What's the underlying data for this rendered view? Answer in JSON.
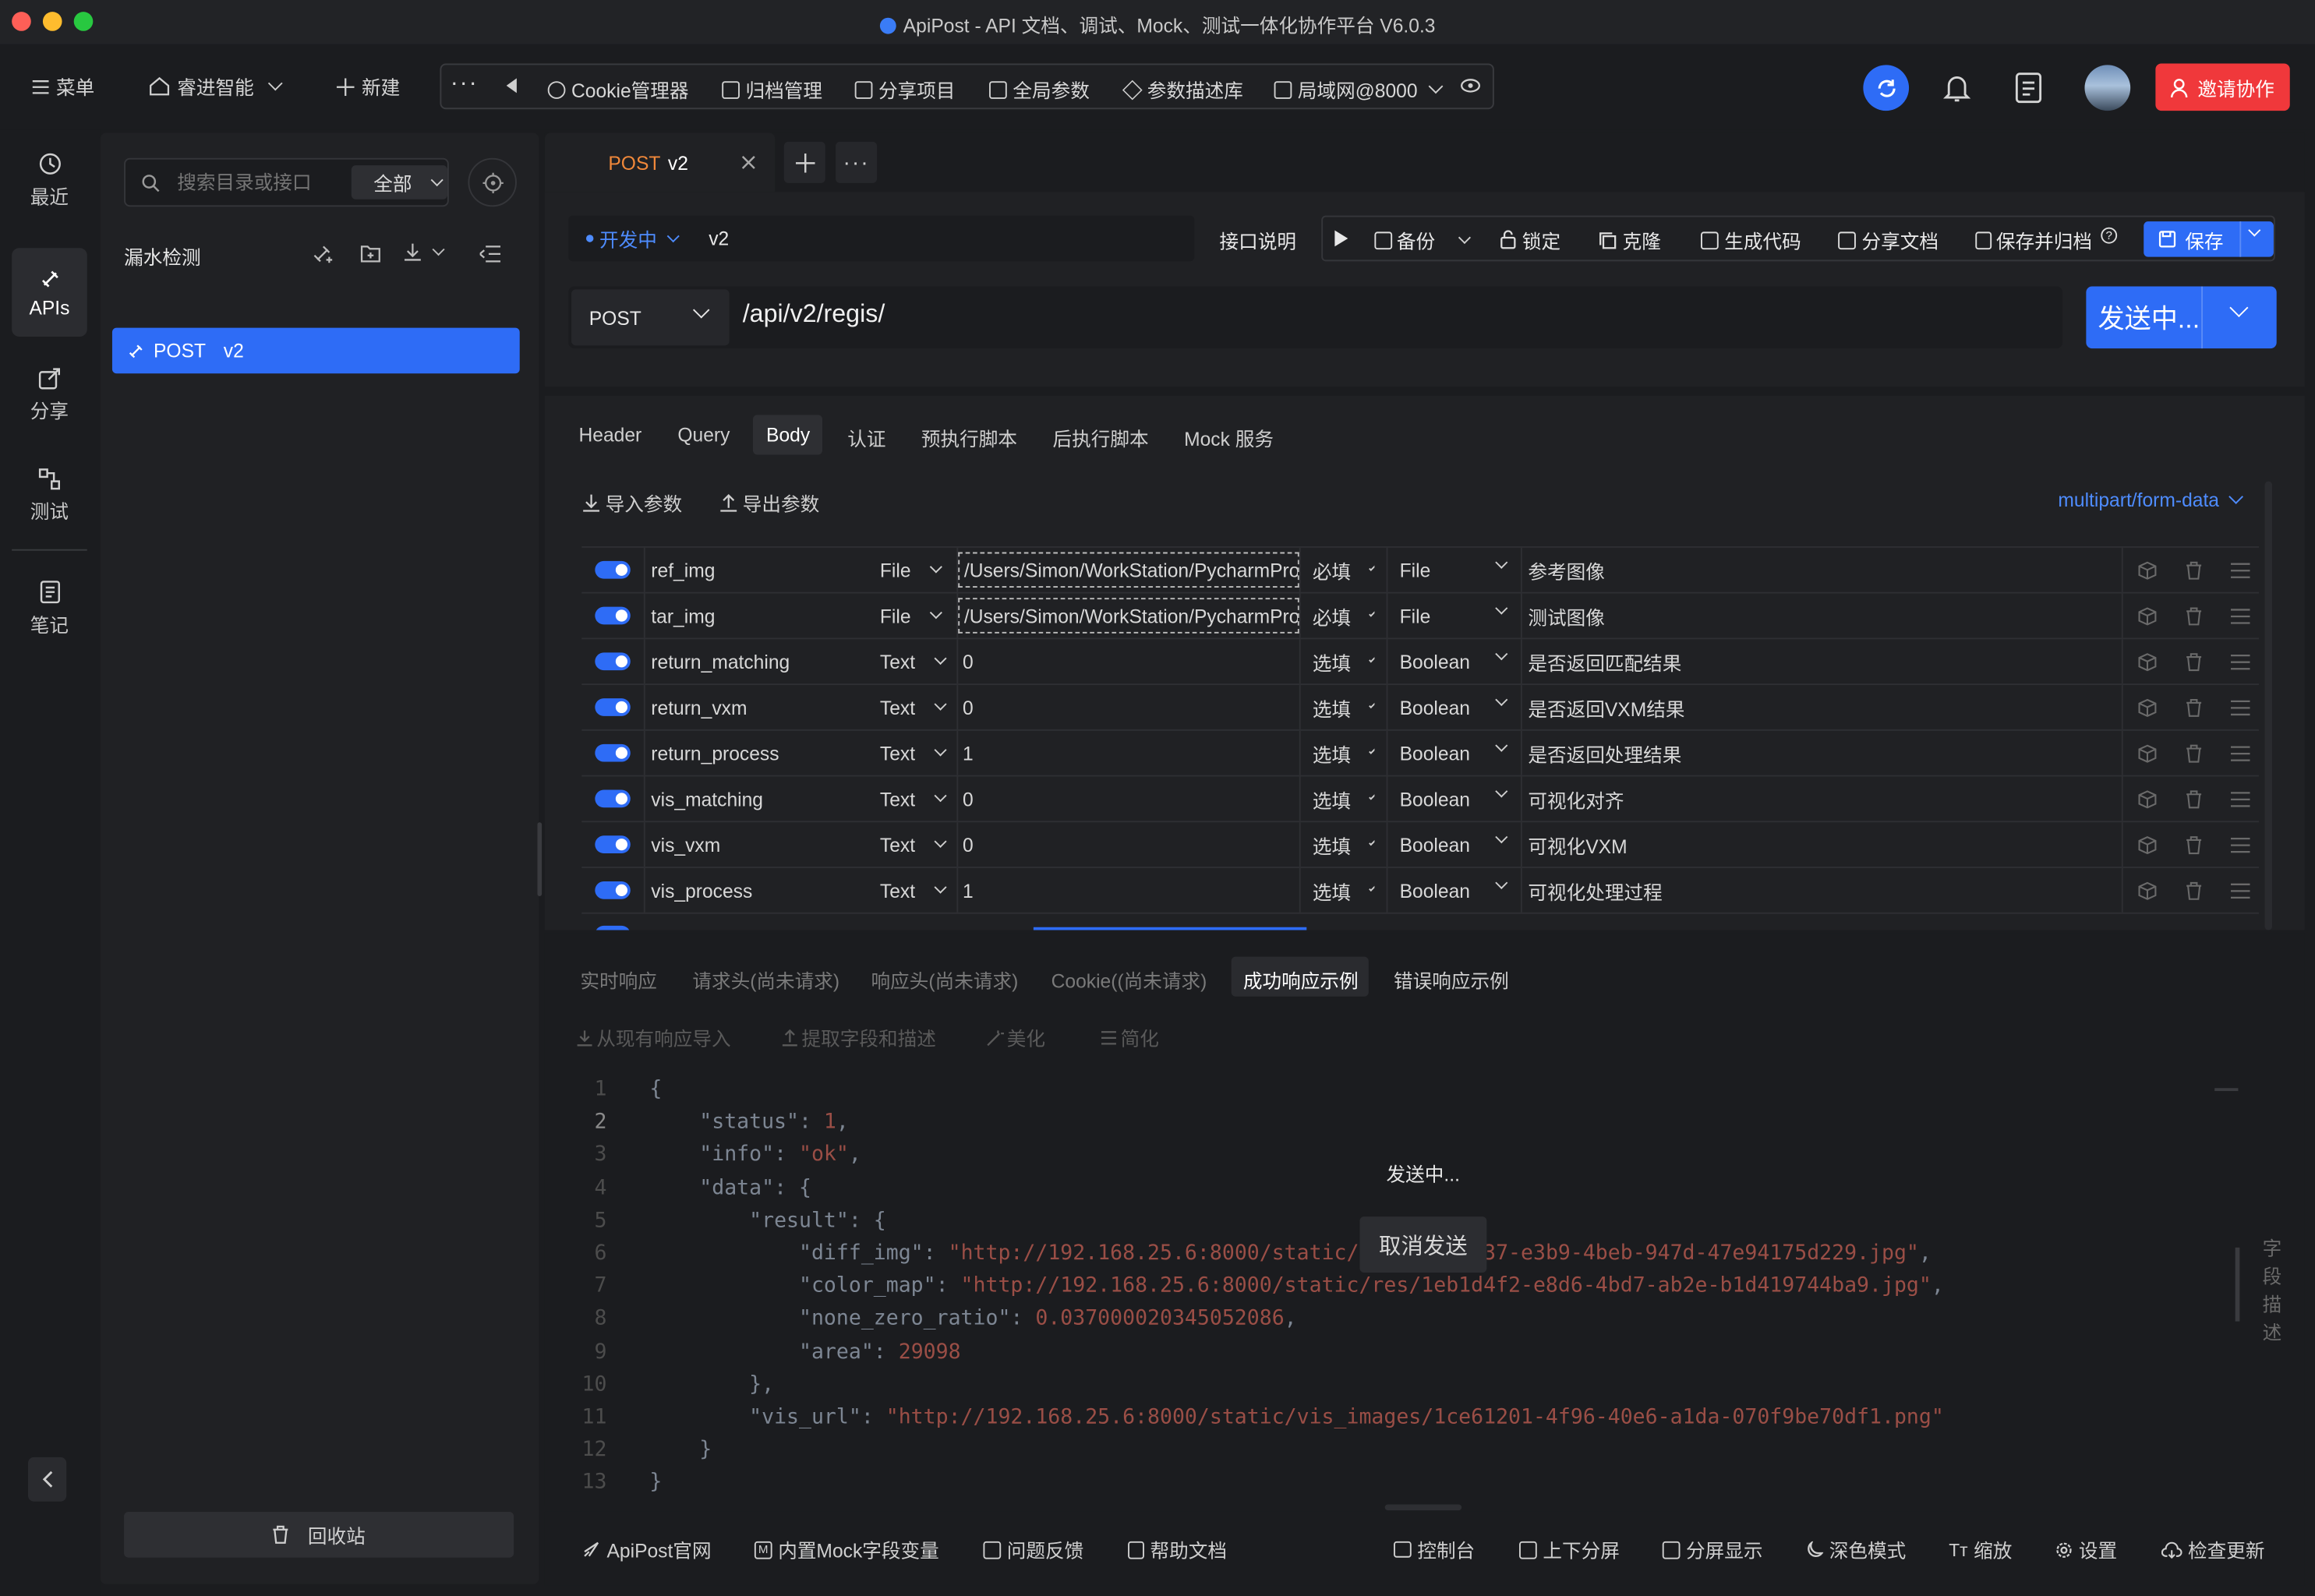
{
  "window": {
    "title": "ApiPost - API 文档、调试、Mock、测试一体化协作平台 V6.0.3"
  },
  "topbar": {
    "menu": "菜单",
    "team": "睿进智能",
    "new": "新建",
    "tools": [
      "Cookie管理器",
      "归档管理",
      "分享项目",
      "全局参数",
      "参数描述库",
      "局域网@8000"
    ],
    "invite": "邀请协作"
  },
  "rail": {
    "items": [
      "最近",
      "APIs",
      "分享",
      "测试",
      "笔记"
    ]
  },
  "sidebar": {
    "search_placeholder": "搜索目录或接口",
    "filter": "全部",
    "project": "漏水检测",
    "tree": [
      {
        "method": "POST",
        "name": "v2"
      }
    ],
    "recycle": "回收站"
  },
  "tab": {
    "method": "POST",
    "name": "v2"
  },
  "request": {
    "env": "开发中",
    "name": "v2",
    "doc": "接口说明",
    "actions": [
      "备份",
      "锁定",
      "克隆",
      "生成代码",
      "分享文档",
      "保存并归档"
    ],
    "save": "保存",
    "method": "POST",
    "url": "/api/v2/regis/",
    "send": "发送中..."
  },
  "body": {
    "tabs": [
      "Header",
      "Query",
      "Body",
      "认证",
      "预执行脚本",
      "后执行脚本",
      "Mock 服务"
    ],
    "import": "导入参数",
    "export": "导出参数",
    "content_type": "multipart/form-data",
    "rows": [
      {
        "key": "ref_img",
        "type": "File",
        "value": "/Users/Simon/WorkStation/PycharmProj",
        "req": "必填",
        "dtype": "File",
        "desc": "参考图像"
      },
      {
        "key": "tar_img",
        "type": "File",
        "value": "/Users/Simon/WorkStation/PycharmProj",
        "req": "必填",
        "dtype": "File",
        "desc": "测试图像"
      },
      {
        "key": "return_matching",
        "type": "Text",
        "value": "0",
        "req": "选填",
        "dtype": "Boolean",
        "desc": "是否返回匹配结果"
      },
      {
        "key": "return_vxm",
        "type": "Text",
        "value": "0",
        "req": "选填",
        "dtype": "Boolean",
        "desc": "是否返回VXM结果"
      },
      {
        "key": "return_process",
        "type": "Text",
        "value": "1",
        "req": "选填",
        "dtype": "Boolean",
        "desc": "是否返回处理结果"
      },
      {
        "key": "vis_matching",
        "type": "Text",
        "value": "0",
        "req": "选填",
        "dtype": "Boolean",
        "desc": "可视化对齐"
      },
      {
        "key": "vis_vxm",
        "type": "Text",
        "value": "0",
        "req": "选填",
        "dtype": "Boolean",
        "desc": "可视化VXM"
      },
      {
        "key": "vis_process",
        "type": "Text",
        "value": "1",
        "req": "选填",
        "dtype": "Boolean",
        "desc": "可视化处理过程"
      }
    ]
  },
  "response": {
    "tabs": [
      "实时响应",
      "请求头(尚未请求)",
      "响应头(尚未请求)",
      "Cookie((尚未请求)",
      "成功响应示例",
      "错误响应示例"
    ],
    "tools": [
      "从现有响应导入",
      "提取字段和描述",
      "美化",
      "简化"
    ],
    "lines": [
      "{",
      "    \"status\": 1,",
      "    \"info\": \"ok\",",
      "    \"data\": {",
      "        \"result\": {",
      "            \"diff_img\": \"http://192.168.25.6:8000/static/res/66d81f37-e3b9-4beb-947d-47e94175d229.jpg\",",
      "            \"color_map\": \"http://192.168.25.6:8000/static/res/1eb1d4f2-e8d6-4bd7-ab2e-b1d419744ba9.jpg\",",
      "            \"none_zero_ratio\": 0.037000020345052086,",
      "            \"area\": 29098",
      "        },",
      "        \"vis_url\": \"http://192.168.25.6:8000/static/vis_images/1ce61201-4f96-40e6-a1da-070f9be70df1.png\"",
      "    }",
      "}"
    ],
    "sending": "发送中...",
    "cancel": "取消发送",
    "side_label": [
      "字",
      "段",
      "描",
      "述"
    ]
  },
  "footer": {
    "left": [
      "ApiPost官网",
      "内置Mock字段变量",
      "问题反馈",
      "帮助文档"
    ],
    "right": [
      "控制台",
      "上下分屏",
      "分屏显示",
      "深色模式",
      "缩放",
      "设置",
      "检查更新"
    ]
  },
  "colors": {
    "accent": "#2e6cf6",
    "danger": "#f0383b",
    "post": "#f0883a",
    "string": "#d2574a",
    "number": "#d2574a"
  }
}
